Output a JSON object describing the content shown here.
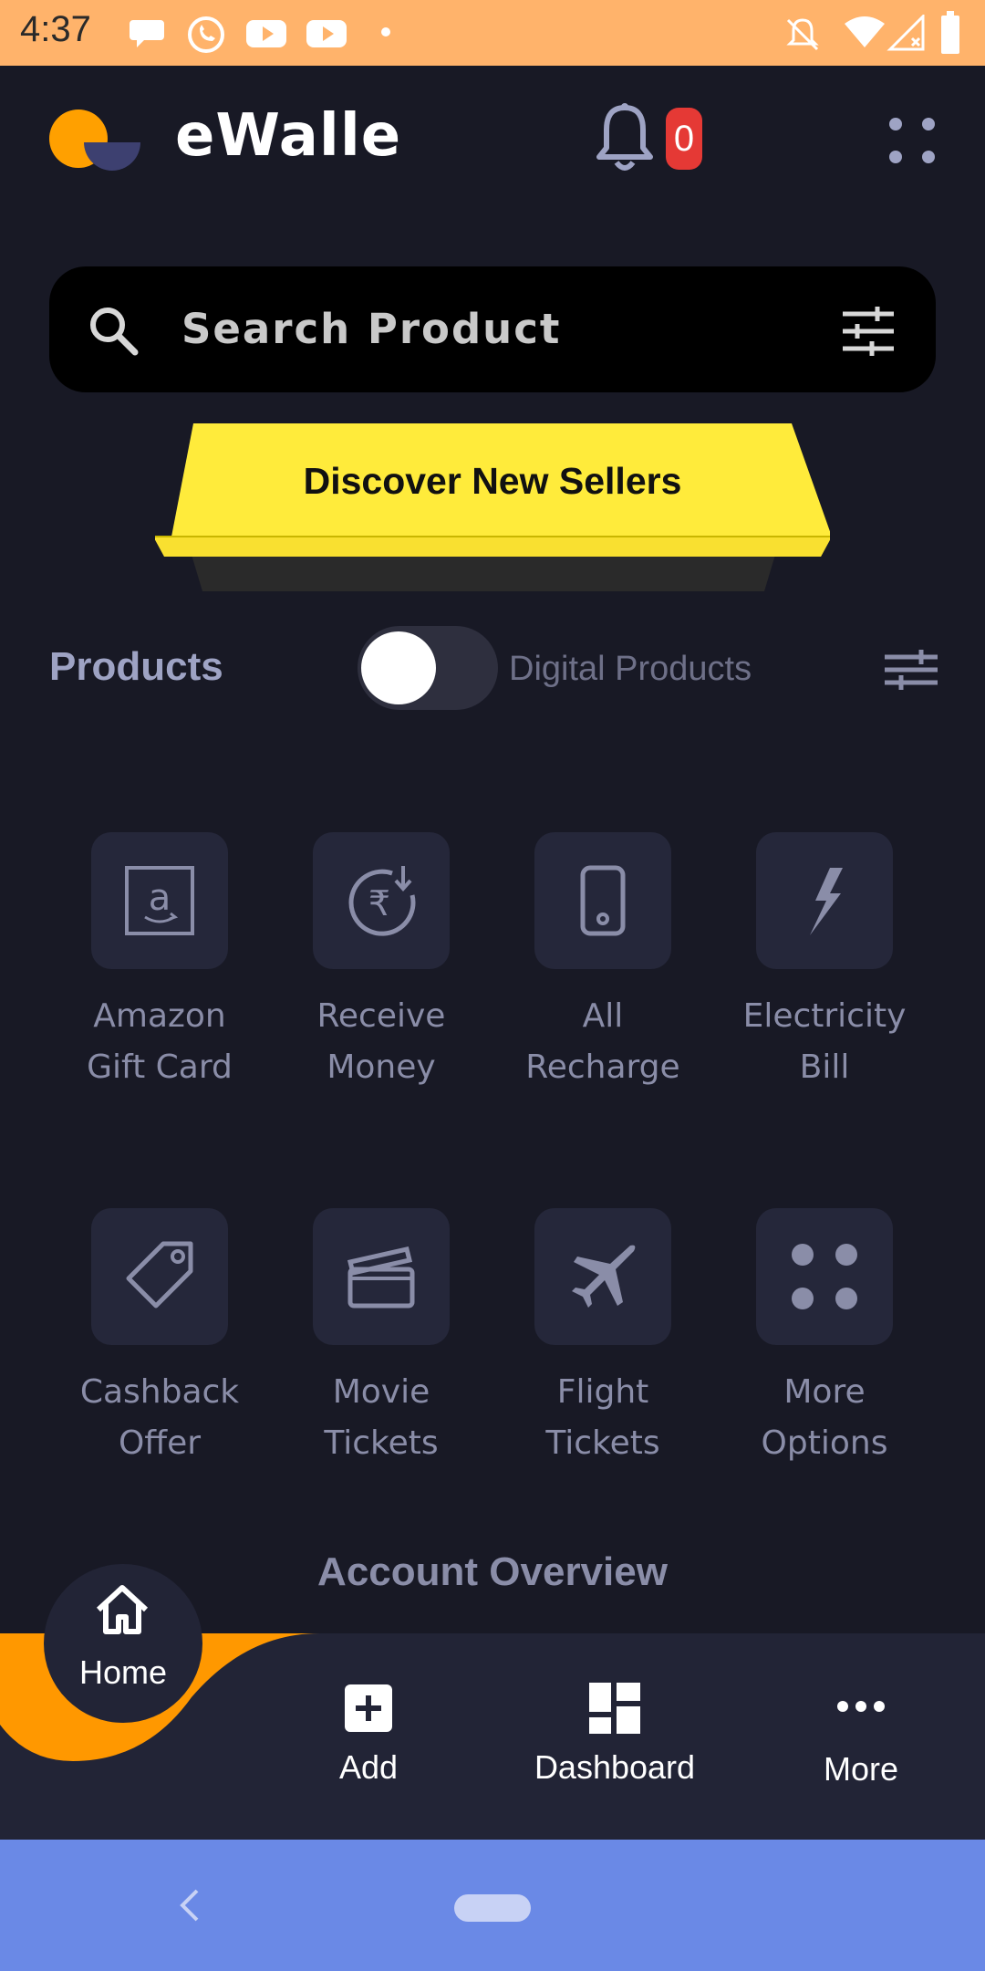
{
  "status_bar": {
    "time": "4:37"
  },
  "header": {
    "brand": "eWalle",
    "notification_count": "0"
  },
  "search": {
    "placeholder": "Search Product"
  },
  "banner": {
    "label": "Discover New Sellers"
  },
  "products": {
    "title": "Products",
    "toggle_label": "Digital Products",
    "toggle_on": false
  },
  "services": [
    {
      "label_line1": "Amazon",
      "label_line2": "Gift Card",
      "icon": "amazon-icon"
    },
    {
      "label_line1": "Receive",
      "label_line2": "Money",
      "icon": "rupee-receive-icon"
    },
    {
      "label_line1": "All",
      "label_line2": "Recharge",
      "icon": "phone-icon"
    },
    {
      "label_line1": "Electricity",
      "label_line2": "Bill",
      "icon": "lightning-icon"
    },
    {
      "label_line1": "Cashback",
      "label_line2": "Offer",
      "icon": "tag-icon"
    },
    {
      "label_line1": "Movie",
      "label_line2": "Tickets",
      "icon": "clapperboard-icon"
    },
    {
      "label_line1": "Flight",
      "label_line2": "Tickets",
      "icon": "airplane-icon"
    },
    {
      "label_line1": "More",
      "label_line2": "Options",
      "icon": "four-dots-icon"
    }
  ],
  "overview": {
    "title": "Account Overview"
  },
  "bottom_nav": {
    "home": "Home",
    "add": "Add",
    "dashboard": "Dashboard",
    "more": "More"
  },
  "colors": {
    "status_bar": "#FFB36B",
    "background": "#181925",
    "banner": "#FFEB3B",
    "accent_orange": "#FF9800",
    "badge": "#E53935",
    "system_nav": "#6A89E6"
  }
}
